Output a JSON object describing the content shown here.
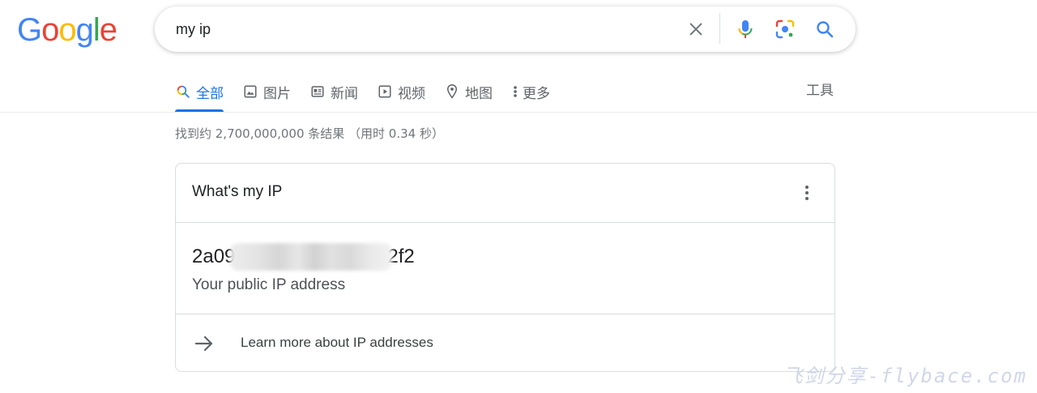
{
  "header": {
    "logo_letters": [
      {
        "char": "G",
        "color": "#4285F4"
      },
      {
        "char": "o",
        "color": "#EA4335"
      },
      {
        "char": "o",
        "color": "#FBBC05"
      },
      {
        "char": "g",
        "color": "#4285F4"
      },
      {
        "char": "l",
        "color": "#34A853"
      },
      {
        "char": "e",
        "color": "#EA4335"
      }
    ],
    "search": {
      "value": "my ip",
      "clear_icon": "close-icon",
      "voice_icon": "microphone-icon",
      "lens_icon": "camera-lens-icon",
      "submit_icon": "search-icon"
    }
  },
  "tabs": {
    "items": [
      {
        "label": "全部",
        "icon": "search-icon",
        "active": true
      },
      {
        "label": "图片",
        "icon": "image-icon",
        "active": false
      },
      {
        "label": "新闻",
        "icon": "news-icon",
        "active": false
      },
      {
        "label": "视频",
        "icon": "video-icon",
        "active": false
      },
      {
        "label": "地图",
        "icon": "map-pin-icon",
        "active": false
      },
      {
        "label": "更多",
        "icon": "more-vert-icon",
        "active": false
      }
    ],
    "tools_label": "工具"
  },
  "results": {
    "stats": "找到约 2,700,000,000 条结果  （用时 0.34 秒）"
  },
  "ip_card": {
    "title": "What's my IP",
    "menu_icon": "more-vert-icon",
    "ip_prefix": "2a09",
    "ip_suffix": "2f2",
    "ip_caption": "Your public IP address",
    "learn_more": "Learn more about IP addresses",
    "learn_more_icon": "arrow-right-icon"
  },
  "watermark": "飞剑分享-flybace.com",
  "colors": {
    "accent": "#1a73e8",
    "text_primary": "#202124",
    "text_secondary": "#70757a",
    "border": "#dadce0"
  }
}
